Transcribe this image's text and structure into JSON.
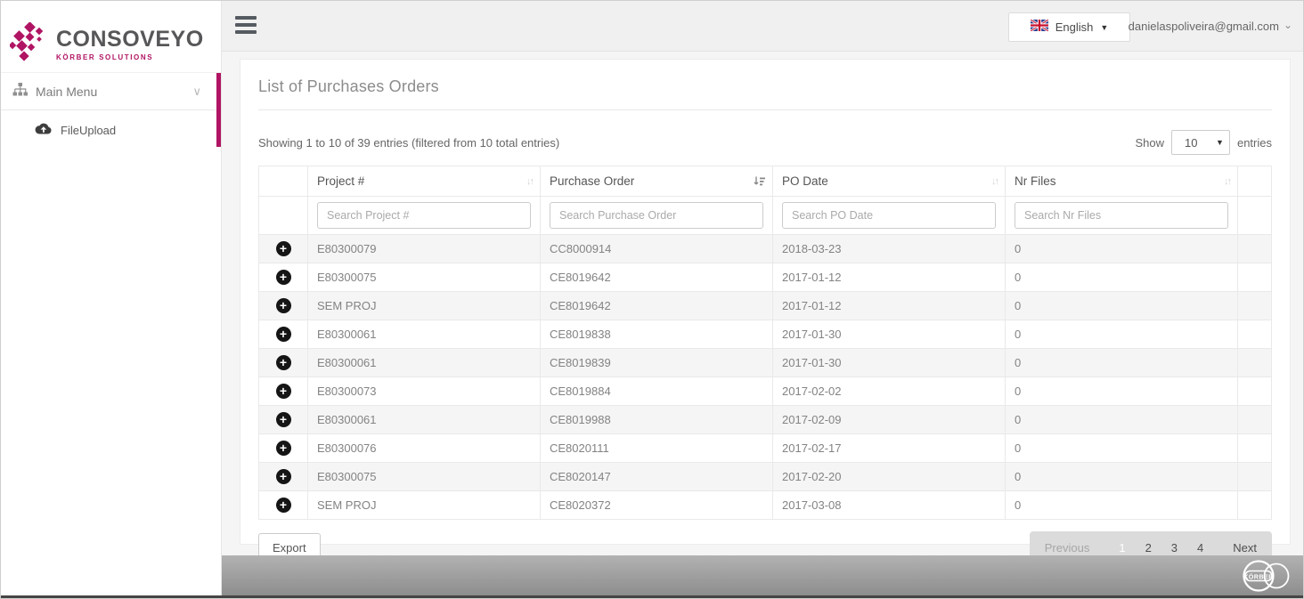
{
  "brand": {
    "name": "CONSOVEYO",
    "tagline": "KÖRBER SOLUTIONS"
  },
  "colors": {
    "accent": "#b01463",
    "topbar_bg": "#f0f0f0",
    "main_bg": "#f5f5f5",
    "stripe_bg": "#f5f5f5",
    "footer_top": "#b2b2b2",
    "footer_bottom": "#8d8d8d"
  },
  "sidebar": {
    "items": [
      {
        "label": "Main Menu"
      },
      {
        "label": "FileUpload"
      }
    ]
  },
  "topbar": {
    "language": "English",
    "user_email": "danielaspoliveira@gmail.com"
  },
  "page": {
    "title": "List of Purchases Orders",
    "info": "Showing 1 to 10 of 39 entries (filtered from 10 total entries)",
    "show_label": "Show",
    "entries_label": "entries",
    "page_size": "10",
    "export_label": "Export"
  },
  "table": {
    "columns": [
      {
        "label": "Project #",
        "sorted": false
      },
      {
        "label": "Purchase Order",
        "sorted": true
      },
      {
        "label": "PO Date",
        "sorted": false
      },
      {
        "label": "Nr Files",
        "sorted": false
      }
    ],
    "filters": [
      "Search Project #",
      "Search Purchase Order",
      "Search PO Date",
      "Search Nr Files"
    ],
    "rows": [
      {
        "project": "E80300079",
        "purchase_order": "CC8000914",
        "po_date": "2018-03-23",
        "nr_files": "0"
      },
      {
        "project": "E80300075",
        "purchase_order": "CE8019642",
        "po_date": "2017-01-12",
        "nr_files": "0"
      },
      {
        "project": "SEM PROJ",
        "purchase_order": "CE8019642",
        "po_date": "2017-01-12",
        "nr_files": "0"
      },
      {
        "project": "E80300061",
        "purchase_order": "CE8019838",
        "po_date": "2017-01-30",
        "nr_files": "0"
      },
      {
        "project": "E80300061",
        "purchase_order": "CE8019839",
        "po_date": "2017-01-30",
        "nr_files": "0"
      },
      {
        "project": "E80300073",
        "purchase_order": "CE8019884",
        "po_date": "2017-02-02",
        "nr_files": "0"
      },
      {
        "project": "E80300061",
        "purchase_order": "CE8019988",
        "po_date": "2017-02-09",
        "nr_files": "0"
      },
      {
        "project": "E80300076",
        "purchase_order": "CE8020111",
        "po_date": "2017-02-17",
        "nr_files": "0"
      },
      {
        "project": "E80300075",
        "purchase_order": "CE8020147",
        "po_date": "2017-02-20",
        "nr_files": "0"
      },
      {
        "project": "SEM PROJ",
        "purchase_order": "CE8020372",
        "po_date": "2017-03-08",
        "nr_files": "0"
      }
    ]
  },
  "pagination": {
    "previous": "Previous",
    "pages": [
      "1",
      "2",
      "3",
      "4"
    ],
    "current": "1",
    "next": "Next"
  },
  "footer": {
    "logo_text": "KÖRBER"
  }
}
